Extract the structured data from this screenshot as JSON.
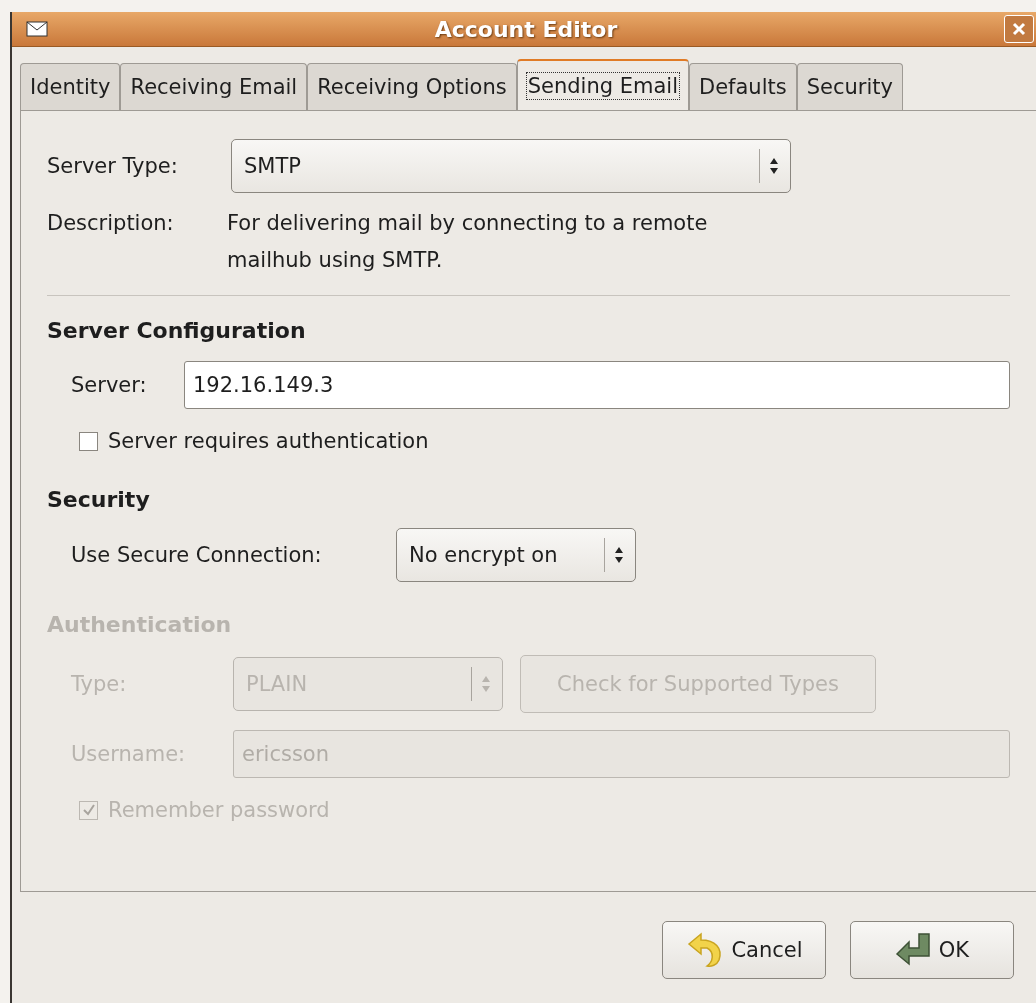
{
  "window": {
    "title": "Account Editor"
  },
  "tabs": [
    {
      "label": "Identity",
      "selected": false
    },
    {
      "label": "Receiving Email",
      "selected": false
    },
    {
      "label": "Receiving Options",
      "selected": false
    },
    {
      "label": "Sending Email",
      "selected": true
    },
    {
      "label": "Defaults",
      "selected": false
    },
    {
      "label": "Security",
      "selected": false
    }
  ],
  "server_type": {
    "label": "Server Type:",
    "value": "SMTP"
  },
  "description": {
    "label": "Description:",
    "text": "For delivering mail by connecting to a remote mailhub using SMTP."
  },
  "server_configuration": {
    "heading": "Server Configuration",
    "server_label": "Server:",
    "server_value": "192.16.149.3",
    "auth_checkbox": {
      "label": "Server requires authentication",
      "checked": false
    }
  },
  "security": {
    "heading": "Security",
    "connection_label": "Use Secure Connection:",
    "connection_value": "No encrypt on"
  },
  "authentication": {
    "heading": "Authentication",
    "disabled": true,
    "type_label": "Type:",
    "type_value": "PLAIN",
    "check_button": "Check for Supported Types",
    "username_label": "Username:",
    "username_value": "ericsson",
    "remember": {
      "label": "Remember password",
      "checked": true
    }
  },
  "buttons": [
    {
      "kind": "cancel",
      "label": "Cancel"
    },
    {
      "kind": "ok",
      "label": "OK"
    }
  ]
}
